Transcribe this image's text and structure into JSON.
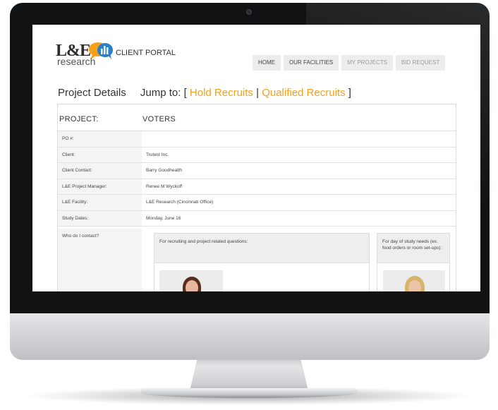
{
  "brand": {
    "logo_main": "L&E",
    "logo_sub": "research",
    "portal_title": "CLIENT PORTAL",
    "accent_color": "#f6a01b"
  },
  "nav": {
    "items": [
      {
        "label": "HOME",
        "active": true
      },
      {
        "label": "OUR FACILITIES",
        "active": true
      },
      {
        "label": "MY PROJECTS",
        "active": false
      },
      {
        "label": "BID REQUEST",
        "active": false
      }
    ]
  },
  "page": {
    "title": "Project Details",
    "jump_prefix": "Jump to: [",
    "jump_link_1": "Hold Recruits",
    "jump_separator": "|",
    "jump_link_2": "Qualified Recruits",
    "jump_suffix": "]"
  },
  "project": {
    "label": "PROJECT:",
    "value": "VOTERS"
  },
  "details": [
    {
      "label": "PO #:",
      "value": ""
    },
    {
      "label": "Client:",
      "value": "Trutest Inc."
    },
    {
      "label": "Client Contact:",
      "value": "Barry Goodhealth"
    },
    {
      "label": "L&E Project Manager:",
      "value": "Renee M Wyckoff"
    },
    {
      "label": "L&E Facility:",
      "value": "L&E Research (Cincinnati Office)"
    },
    {
      "label": "Study Dates:",
      "value": "Monday, June 16"
    }
  ],
  "contact": {
    "label": "Who do I contact?",
    "box_a_text": "For recruiting and project related questions:",
    "box_b_text": "For day of study needs (ex. food orders or room set-ups):"
  }
}
